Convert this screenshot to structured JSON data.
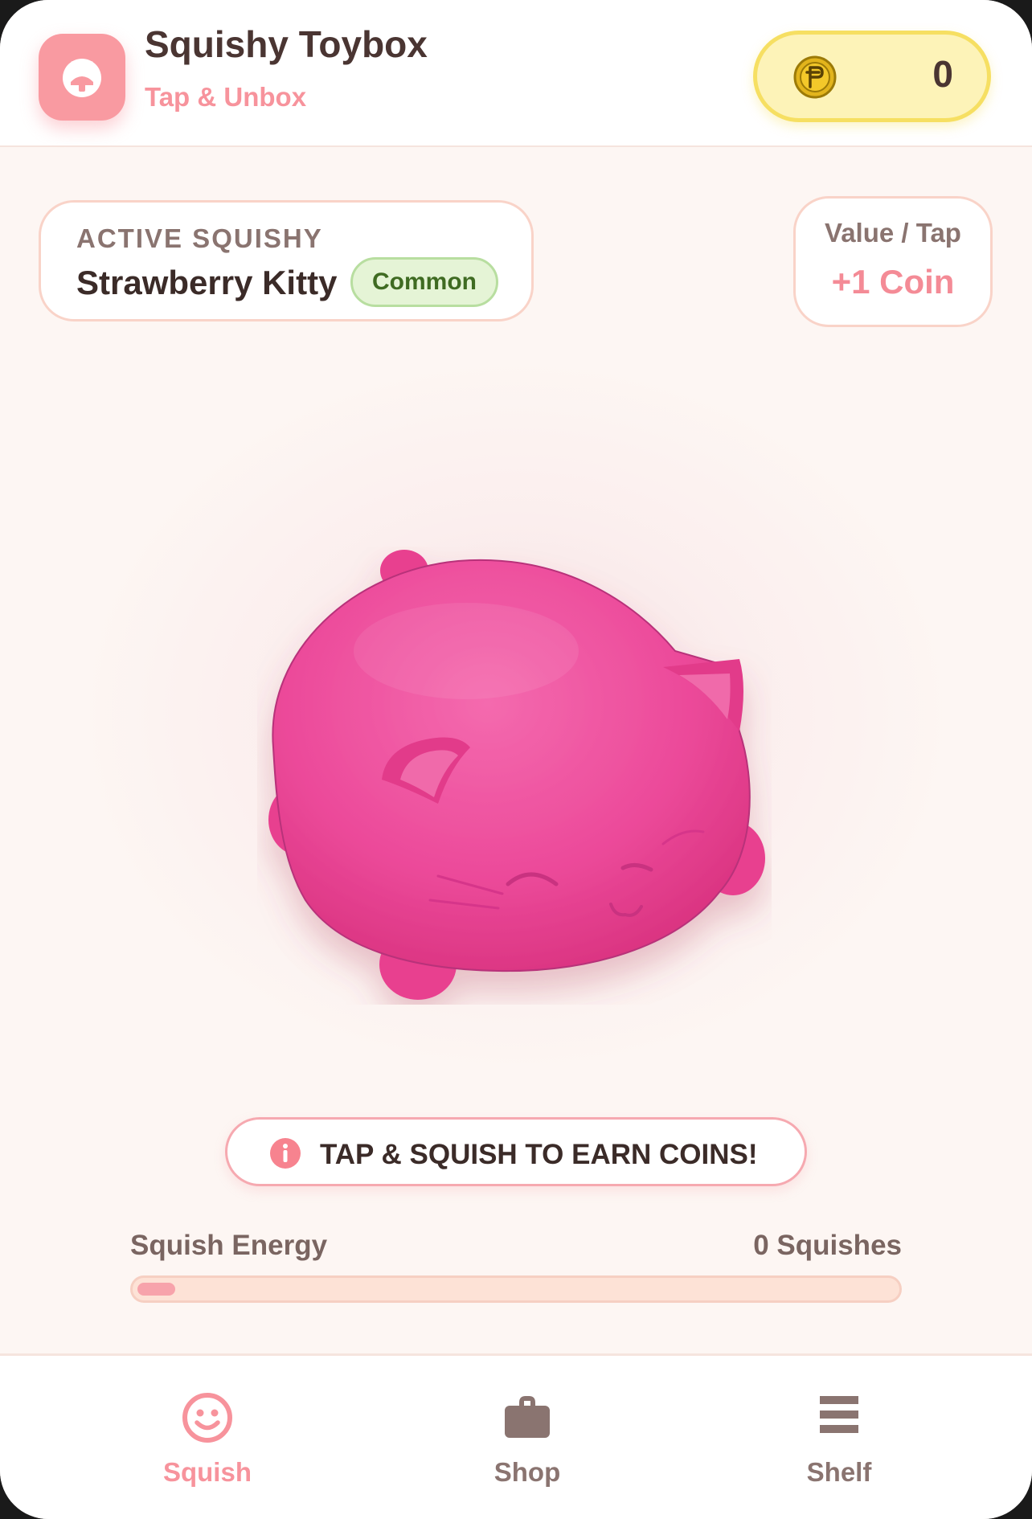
{
  "header": {
    "title": "Squishy Toybox",
    "subtitle": "Tap & Unbox",
    "coins": "0",
    "logo_icon": "cat-face-icon",
    "coin_icon": "coin-icon"
  },
  "active": {
    "label": "ACTIVE SQUISHY",
    "name": "Strawberry Kitty",
    "rarity": "Common"
  },
  "value": {
    "label": "Value / Tap",
    "amount": "+1 Coin"
  },
  "hint": {
    "text": "TAP & SQUISH TO EARN COINS!",
    "icon": "info-icon"
  },
  "energy": {
    "label": "Squish Energy",
    "count": "0 Squishes",
    "fill_percent": 5
  },
  "nav": {
    "items": [
      {
        "label": "Squish",
        "icon": "smiley-icon",
        "active": true
      },
      {
        "label": "Shop",
        "icon": "briefcase-icon",
        "active": false
      },
      {
        "label": "Shelf",
        "icon": "shelf-icon",
        "active": false
      }
    ]
  },
  "colors": {
    "accent": "#f7939c",
    "squishy": "#ec4a9a",
    "coin_bg": "#fdf3b8",
    "coin_border": "#f6df62",
    "rarity_bg": "#e5f4d6",
    "text_dark": "#3b2b28",
    "nav_inactive": "#8a7470"
  }
}
